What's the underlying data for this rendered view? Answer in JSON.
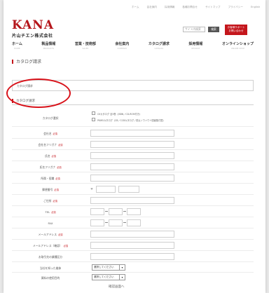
{
  "util_links": [
    "ホーム",
    "会社案内",
    "採用情報",
    "各種お問合せ",
    "サイトマップ",
    "プライバシー",
    "English"
  ],
  "logo": {
    "main": "KANA",
    "sub": "片山チエン株式会社"
  },
  "search": {
    "placeholder": "サイト内検索",
    "button": "検索"
  },
  "support_button": {
    "line1": "お客様サポート",
    "line2": "お問い合わせ"
  },
  "nav": [
    {
      "label": "ホーム",
      "sub": "HOME"
    },
    {
      "label": "製品情報",
      "sub": "PRODUCTS"
    },
    {
      "label": "営業・技術部",
      "sub": "SALES"
    },
    {
      "label": "会社案内",
      "sub": "COMPANY"
    },
    {
      "label": "カタログ請求",
      "sub": "CATALOG"
    },
    {
      "label": "採用情報",
      "sub": "RECRUIT"
    },
    {
      "label": "オンラインショップ",
      "sub": "ONLINE SHOP"
    }
  ],
  "breadcrumb": "カタログ請求",
  "box_text": "カタログ請求",
  "section_title": "カタログ請求",
  "form": {
    "required": "必須",
    "catalog_label": "カタログ選択",
    "catalog_options": [
      "CKカタログ 全3巻（ISBN／CD-ROM付き）",
      "PKW5カタログ（CB／CCBカタログ／防災ノウハウ＋図面集付属）"
    ],
    "labels": {
      "company": "会社名",
      "company_kana": "会社名フリガナ",
      "name": "氏名",
      "name_kana": "氏名フリガナ",
      "department": "所属・役職",
      "zip": "郵便番号",
      "address": "ご住所",
      "tel": "TEL",
      "fax": "FAX",
      "email": "メールアドレス",
      "email_confirm": "メールアドレス（確認）",
      "industry": "お取引先の業種区分",
      "source": "当社を知った媒体",
      "purpose": "資料の使用目的"
    },
    "zip_mark": "〒",
    "select_default": "選択してください",
    "submit": "確認画面へ"
  }
}
